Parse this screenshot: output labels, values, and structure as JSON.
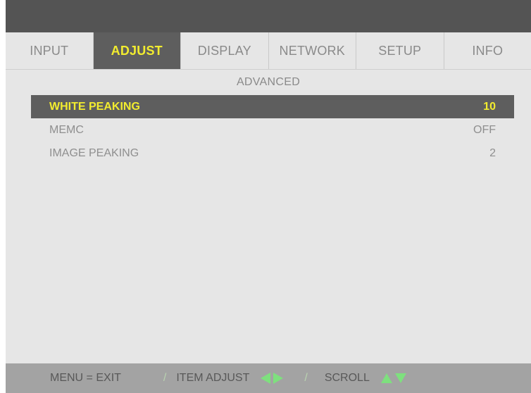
{
  "tabs": [
    {
      "label": "INPUT",
      "active": false
    },
    {
      "label": "ADJUST",
      "active": true
    },
    {
      "label": "DISPLAY",
      "active": false
    },
    {
      "label": "NETWORK",
      "active": false
    },
    {
      "label": "SETUP",
      "active": false
    },
    {
      "label": "INFO",
      "active": false
    }
  ],
  "section": {
    "title": "ADVANCED"
  },
  "settings": [
    {
      "label": "WHITE PEAKING",
      "value": "10",
      "selected": true
    },
    {
      "label": "MEMC",
      "value": "OFF",
      "selected": false
    },
    {
      "label": "IMAGE PEAKING",
      "value": "2",
      "selected": false
    }
  ],
  "footer": {
    "exit_hint": "MENU = EXIT",
    "separator": "/",
    "adjust_hint": "ITEM ADJUST",
    "scroll_hint": "SCROLL",
    "adjust_icons": [
      "arrow-left-icon",
      "arrow-right-icon"
    ],
    "scroll_icons": [
      "arrow-up-icon",
      "arrow-down-icon"
    ]
  },
  "colors": {
    "highlight_text": "#f2ec2f",
    "highlight_bg": "#5e5e5e",
    "panel_bg": "#e6e6e6",
    "footer_bg": "#a3a3a3",
    "arrow_green": "#7ee07e"
  }
}
